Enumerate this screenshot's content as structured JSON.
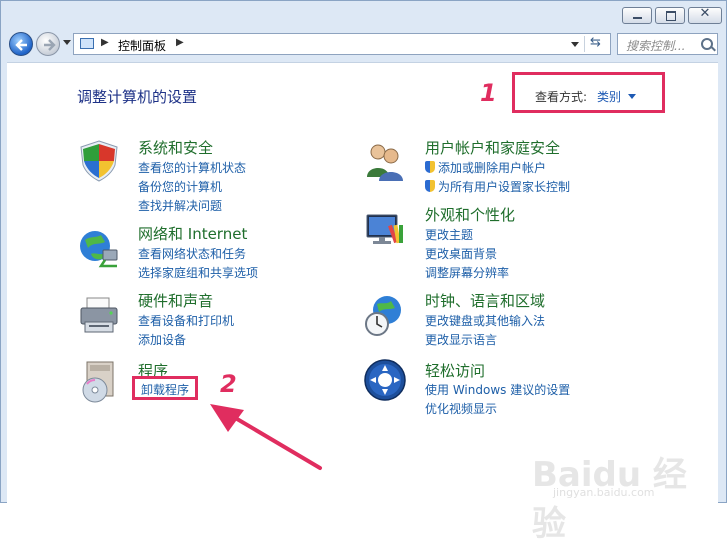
{
  "nav": {
    "address_path": "控制面板",
    "search_placeholder": "搜索控制...",
    "close_glyph": "✕"
  },
  "header": {
    "title": "调整计算机的设置",
    "view_by_label": "查看方式:",
    "view_by_value": "类别"
  },
  "annotations": {
    "marker_1": "1",
    "marker_2": "2",
    "color": "#e02d5f"
  },
  "categories": [
    {
      "title": "系统和安全",
      "icon": "shield-icon",
      "links": [
        "查看您的计算机状态",
        "备份您的计算机",
        "查找并解决问题"
      ]
    },
    {
      "title": "网络和 Internet",
      "icon": "network-globe-icon",
      "links": [
        "查看网络状态和任务",
        "选择家庭组和共享选项"
      ]
    },
    {
      "title": "硬件和声音",
      "icon": "printer-icon",
      "links": [
        "查看设备和打印机",
        "添加设备"
      ]
    },
    {
      "title": "程序",
      "icon": "programs-disc-icon",
      "links": [
        "卸载程序"
      ]
    },
    {
      "title": "用户帐户和家庭安全",
      "icon": "users-icon",
      "links": [
        "添加或删除用户帐户",
        "为所有用户设置家长控制"
      ]
    },
    {
      "title": "外观和个性化",
      "icon": "monitor-palette-icon",
      "links": [
        "更改主题",
        "更改桌面背景",
        "调整屏幕分辨率"
      ]
    },
    {
      "title": "时钟、语言和区域",
      "icon": "globe-clock-icon",
      "links": [
        "更改键盘或其他输入法",
        "更改显示语言"
      ]
    },
    {
      "title": "轻松访问",
      "icon": "ease-of-access-icon",
      "links": [
        "使用 Windows 建议的设置",
        "优化视频显示"
      ]
    }
  ],
  "watermark": {
    "text": "Baidu 经验",
    "sub": "jingyan.baidu.com"
  },
  "colors": {
    "title_blue": "#1e3287",
    "category_green": "#1f6e2c",
    "link_blue": "#1e5fa8",
    "highlight": "#e02d5f"
  }
}
